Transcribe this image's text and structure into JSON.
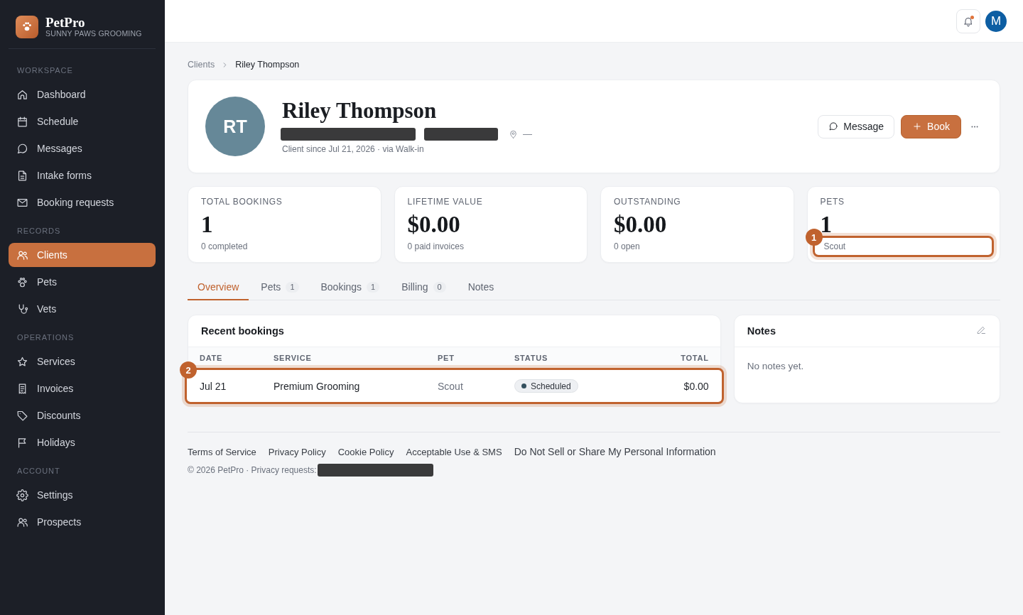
{
  "sidebar": {
    "brand": {
      "name": "PetPro",
      "tagline": "SUNNY PAWS GROOMING"
    },
    "sections": [
      {
        "title": "WORKSPACE",
        "items": [
          {
            "label": "Dashboard",
            "selected": false
          },
          {
            "label": "Schedule",
            "selected": false
          },
          {
            "label": "Messages",
            "selected": false
          },
          {
            "label": "Intake forms",
            "selected": false
          },
          {
            "label": "Booking requests",
            "selected": false
          }
        ]
      },
      {
        "title": "RECORDS",
        "items": [
          {
            "label": "Clients",
            "selected": true
          },
          {
            "label": "Pets",
            "selected": false
          },
          {
            "label": "Vets",
            "selected": false
          }
        ]
      },
      {
        "title": "OPERATIONS",
        "items": [
          {
            "label": "Services",
            "selected": false
          },
          {
            "label": "Invoices",
            "selected": false
          },
          {
            "label": "Discounts",
            "selected": false
          },
          {
            "label": "Holidays",
            "selected": false
          }
        ]
      },
      {
        "title": "ACCOUNT",
        "items": [
          {
            "label": "Settings",
            "selected": false
          },
          {
            "label": "Prospects",
            "selected": false
          }
        ]
      }
    ]
  },
  "topbar": {
    "notifications_unread": true,
    "user_initial": "M"
  },
  "breadcrumb": [
    {
      "label": "Clients",
      "current": false
    },
    {
      "label": "Riley Thompson",
      "current": true
    }
  ],
  "client": {
    "initials": "RT",
    "name": "Riley Thompson",
    "contact": [
      {
        "kind": "redacted"
      },
      {
        "kind": "redacted"
      },
      {
        "kind": "location",
        "value": "—"
      }
    ],
    "since": "Client since Jul 21, 2026 · via Walk-in",
    "actions": [
      {
        "kind": "outline",
        "label": "Message"
      },
      {
        "kind": "filled",
        "label": "Book"
      }
    ]
  },
  "stats": [
    {
      "label": "TOTAL BOOKINGS",
      "value": "1",
      "sub": "0 completed"
    },
    {
      "label": "LIFETIME VALUE",
      "value": "$0.00",
      "sub": "0 paid invoices"
    },
    {
      "label": "OUTSTANDING",
      "value": "$0.00",
      "sub": "0 open"
    },
    {
      "label": "PETS",
      "value": "1",
      "sub": "Scout",
      "highlight": "1"
    }
  ],
  "tabs": [
    {
      "label": "Overview",
      "selected": true
    },
    {
      "label": "Pets",
      "count": "1",
      "selected": false
    },
    {
      "label": "Bookings",
      "count": "1",
      "selected": false
    },
    {
      "label": "Billing",
      "count": "0",
      "selected": false
    },
    {
      "label": "Notes",
      "selected": false
    }
  ],
  "bookings": {
    "title": "Recent bookings",
    "columns": [
      "DATE",
      "SERVICE",
      "PET",
      "STATUS",
      "TOTAL"
    ],
    "rows": [
      {
        "date": "Jul 21",
        "service": "Premium Grooming",
        "pet": "Scout",
        "status": {
          "label": "Scheduled",
          "color": "#34505e"
        },
        "total": "$0.00",
        "highlight": "2"
      }
    ]
  },
  "notes": {
    "title": "Notes",
    "empty_text": "No notes yet."
  },
  "footer": {
    "links": [
      "Terms of Service",
      "Privacy Policy",
      "Cookie Policy",
      "Acceptable Use & SMS",
      "Do Not Sell or Share My Personal Information"
    ],
    "privacy_note": "© 2026 PetPro · Privacy requests:",
    "privacy_contact_redacted": true
  }
}
